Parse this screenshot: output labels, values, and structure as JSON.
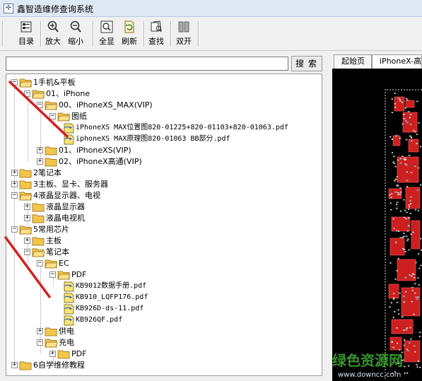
{
  "window": {
    "title": "鑫智造维修查询系统"
  },
  "toolbar": {
    "buttons": [
      {
        "label": "目录",
        "icon": "catalog-icon"
      },
      {
        "label": "放大",
        "icon": "zoom-in-icon"
      },
      {
        "label": "缩小",
        "icon": "zoom-out-icon"
      },
      {
        "label": "全显",
        "icon": "fit-all-icon"
      },
      {
        "label": "刷新",
        "icon": "refresh-icon"
      },
      {
        "label": "查找",
        "icon": "find-icon"
      },
      {
        "label": "双开",
        "icon": "dual-open-icon"
      }
    ]
  },
  "search": {
    "value": "",
    "button_label": "搜索"
  },
  "tree": [
    {
      "label": "1手机&平板",
      "expanded": true,
      "type": "folder"
    },
    {
      "label": "01、iPhone",
      "expanded": true,
      "type": "folder"
    },
    {
      "label": "00、iPhoneXS_MAX(VIP)",
      "expanded": true,
      "type": "folder"
    },
    {
      "label": "图纸",
      "expanded": true,
      "type": "folder"
    },
    {
      "label": "iPhoneXS MAX位置图820-01225+820-01103+820-01063.pdf",
      "type": "file"
    },
    {
      "label": "iphoneXS MAX原理图820-01063 BB部分.pdf",
      "type": "file"
    },
    {
      "label": "01、iPhoneXS(VIP)",
      "expanded": false,
      "type": "folder"
    },
    {
      "label": "02、iPhoneX高通(VIP)",
      "expanded": false,
      "type": "folder"
    },
    {
      "label": "2笔记本",
      "expanded": false,
      "type": "folder"
    },
    {
      "label": "3主板、显卡、服务器",
      "expanded": false,
      "type": "folder"
    },
    {
      "label": "4液晶显示器、电视",
      "expanded": true,
      "type": "folder"
    },
    {
      "label": "液晶显示器",
      "expanded": false,
      "type": "folder"
    },
    {
      "label": "液晶电视机",
      "expanded": false,
      "type": "folder"
    },
    {
      "label": "5常用芯片",
      "expanded": true,
      "type": "folder"
    },
    {
      "label": "主板",
      "expanded": false,
      "type": "folder"
    },
    {
      "label": "笔记本",
      "expanded": true,
      "type": "folder"
    },
    {
      "label": "EC",
      "expanded": true,
      "type": "folder"
    },
    {
      "label": "PDF",
      "expanded": true,
      "type": "folder"
    },
    {
      "label": "KB9012数据手册.pdf",
      "type": "file"
    },
    {
      "label": "KB910_LQFP176.pdf",
      "type": "file"
    },
    {
      "label": "KB926D-ds-11.pdf",
      "type": "file"
    },
    {
      "label": "KB926QF.pdf",
      "type": "file"
    },
    {
      "label": "供电",
      "expanded": false,
      "type": "folder"
    },
    {
      "label": "充电",
      "expanded": true,
      "type": "folder"
    },
    {
      "label": "PDF",
      "expanded": false,
      "type": "folder"
    },
    {
      "label": "6自学维修教程",
      "expanded": false,
      "type": "folder"
    }
  ],
  "tabs": [
    {
      "label": "起始页"
    },
    {
      "label": "iPhoneX-高"
    }
  ],
  "watermark": {
    "text": "绿色资源网",
    "url": "www.downcc.com"
  },
  "colors": {
    "annotation": "#d42020",
    "folder": "#f2c64a",
    "board_red": "#cc2020",
    "board_bg": "#000000"
  }
}
